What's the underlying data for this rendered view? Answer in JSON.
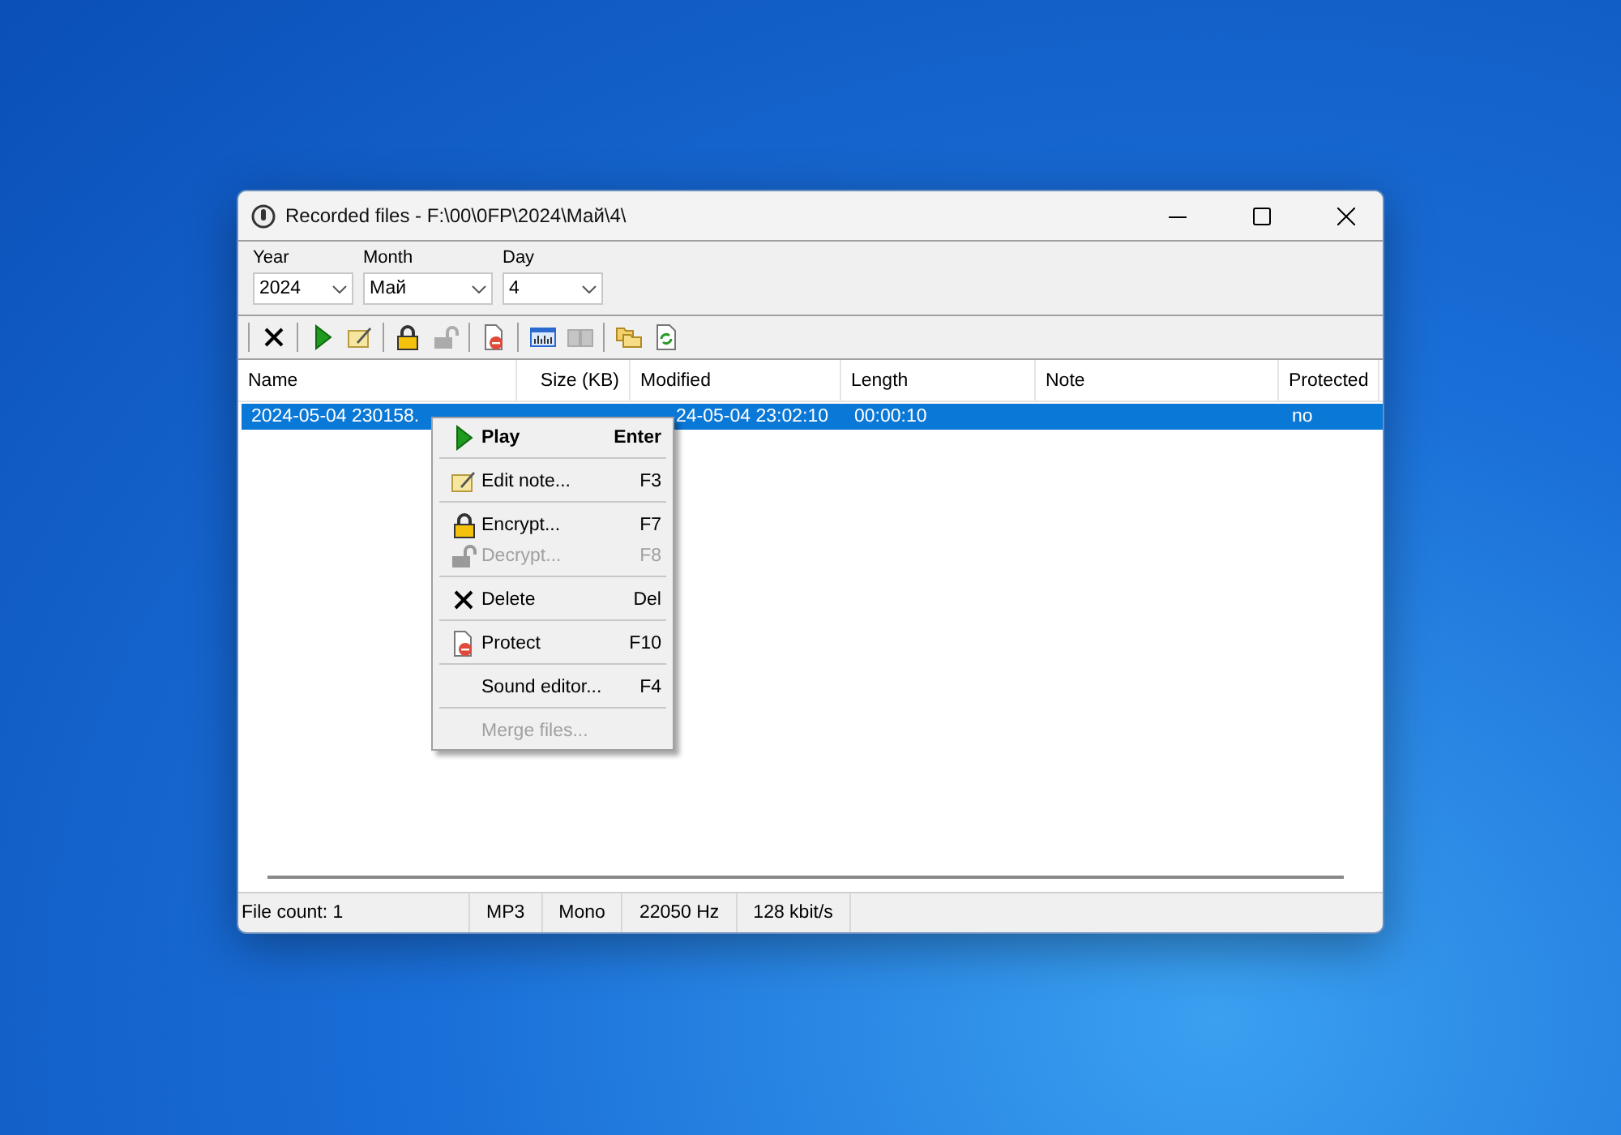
{
  "window": {
    "title": "Recorded files - F:\\00\\0FP\\2024\\Май\\4\\"
  },
  "filters": [
    {
      "label": "Year",
      "value": "2024"
    },
    {
      "label": "Month",
      "value": "Май"
    },
    {
      "label": "Day",
      "value": "4"
    }
  ],
  "toolbar": [
    [
      {
        "kind": "delete",
        "disabled": false
      }
    ],
    [
      {
        "kind": "play",
        "disabled": false
      },
      {
        "kind": "note",
        "disabled": false
      }
    ],
    [
      {
        "kind": "lock",
        "disabled": false
      },
      {
        "kind": "unlock",
        "disabled": true
      }
    ],
    [
      {
        "kind": "protect",
        "disabled": false
      }
    ],
    [
      {
        "kind": "wave",
        "disabled": false
      },
      {
        "kind": "merge",
        "disabled": true
      }
    ],
    [
      {
        "kind": "folders",
        "disabled": false
      },
      {
        "kind": "refresh",
        "disabled": false
      }
    ]
  ],
  "table": {
    "columns": [
      "Name",
      "Size (KB)",
      "Modified",
      "Length",
      "Note",
      "Protected"
    ],
    "rows": [
      {
        "selected": true,
        "cells": [
          "2024-05-04 230158.",
          "",
          "24-05-04 23:02:10",
          "00:00:10",
          "",
          "no"
        ]
      }
    ]
  },
  "context_menu": [
    [
      {
        "kind": "play",
        "label": "Play",
        "shortcut": "Enter",
        "default": true,
        "disabled": false
      }
    ],
    [
      {
        "kind": "note",
        "label": "Edit note...",
        "shortcut": "F3",
        "default": false,
        "disabled": false
      }
    ],
    [
      {
        "kind": "lock",
        "label": "Encrypt...",
        "shortcut": "F7",
        "default": false,
        "disabled": false
      },
      {
        "kind": "unlock",
        "label": "Decrypt...",
        "shortcut": "F8",
        "default": false,
        "disabled": true
      }
    ],
    [
      {
        "kind": "delete",
        "label": "Delete",
        "shortcut": "Del",
        "default": false,
        "disabled": false
      }
    ],
    [
      {
        "kind": "protect",
        "label": "Protect",
        "shortcut": "F10",
        "default": false,
        "disabled": false
      }
    ],
    [
      {
        "kind": "text",
        "label": "Sound editor...",
        "shortcut": "F4",
        "default": false,
        "disabled": false
      }
    ],
    [
      {
        "kind": "text",
        "label": "Merge files...",
        "default": false,
        "disabled": true
      }
    ]
  ],
  "status_bar": [
    "File count: 1",
    "MP3",
    "Mono",
    "22050 Hz",
    "128 kbit/s"
  ]
}
